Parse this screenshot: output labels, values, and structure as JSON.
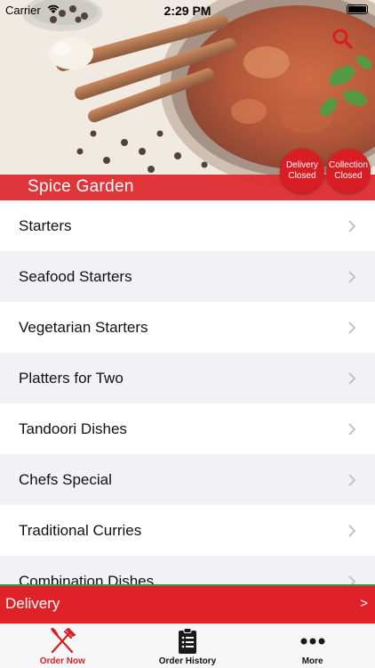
{
  "status_bar": {
    "carrier": "Carrier",
    "time": "2:29 PM"
  },
  "header": {
    "restaurant_name": "Spice Garden",
    "delivery_badge": {
      "line1": "Delivery",
      "line2": "Closed"
    },
    "collection_badge": {
      "line1": "Collection",
      "line2": "Closed"
    }
  },
  "menu": {
    "categories": [
      "Starters",
      "Seafood Starters",
      "Vegetarian Starters",
      "Platters for Two",
      "Tandoori Dishes",
      "Chefs Special",
      "Traditional Curries",
      "Combination Dishes"
    ]
  },
  "order_mode": {
    "label": "Delivery",
    "arrow": ">"
  },
  "tab_bar": {
    "tabs": [
      {
        "label": "Order Now",
        "icon": "fork-knife-icon",
        "active": true
      },
      {
        "label": "Order History",
        "icon": "clipboard-list-icon",
        "active": false
      },
      {
        "label": "More",
        "icon": "more-dots-icon",
        "active": false
      }
    ]
  },
  "colors": {
    "brand_red": "#d81e24",
    "accent_green": "#2e9e43"
  }
}
